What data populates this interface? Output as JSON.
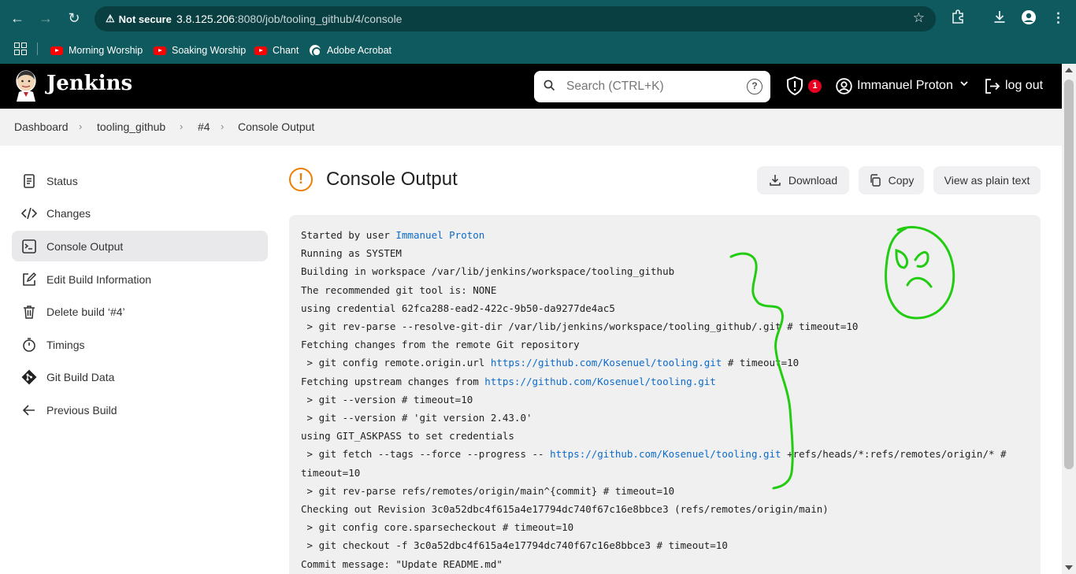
{
  "browser": {
    "security_label": "Not secure",
    "url_host": "3.8.125.206",
    "url_path": ":8080/job/tooling_github/4/console",
    "bookmarks": [
      {
        "label": "Morning Worship",
        "icon": "youtube-icon"
      },
      {
        "label": "Soaking Worship",
        "icon": "youtube-icon"
      },
      {
        "label": "Chant",
        "icon": "youtube-icon"
      },
      {
        "label": "Adobe Acrobat",
        "icon": "acrobat-icon"
      }
    ],
    "theme_color": "#0f5a5e"
  },
  "header": {
    "brand": "Jenkins",
    "search_placeholder": "Search (CTRL+K)",
    "help_label": "?",
    "security_badge_count": "1",
    "user_name": "Immanuel Proton",
    "logout_label": "log out"
  },
  "breadcrumb": {
    "items": [
      "Dashboard",
      "tooling_github",
      "#4",
      "Console Output"
    ]
  },
  "sidebar": {
    "items": [
      {
        "label": "Status",
        "icon": "document-icon"
      },
      {
        "label": "Changes",
        "icon": "code-icon"
      },
      {
        "label": "Console Output",
        "icon": "terminal-icon",
        "active": true
      },
      {
        "label": "Edit Build Information",
        "icon": "edit-icon"
      },
      {
        "label": "Delete build ‘#4’",
        "icon": "trash-icon"
      },
      {
        "label": "Timings",
        "icon": "stopwatch-icon"
      },
      {
        "label": "Git Build Data",
        "icon": "git-icon"
      },
      {
        "label": "Previous Build",
        "icon": "arrow-left-icon"
      }
    ]
  },
  "main": {
    "title": "Console Output",
    "status_icon": "warning-icon",
    "status_color": "#ef7d00",
    "buttons": {
      "download": "Download",
      "copy": "Copy",
      "plain_text": "View as plain text"
    },
    "console_lines": [
      [
        {
          "t": "Started by user "
        },
        {
          "t": "Immanuel Proton",
          "link": true
        }
      ],
      [
        {
          "t": "Running as SYSTEM"
        }
      ],
      [
        {
          "t": "Building in workspace /var/lib/jenkins/workspace/tooling_github"
        }
      ],
      [
        {
          "t": "The recommended git tool is: NONE"
        }
      ],
      [
        {
          "t": "using credential 62fca288-ead2-422c-9b50-da9277de4ac5"
        }
      ],
      [
        {
          "t": " > git rev-parse --resolve-git-dir /var/lib/jenkins/workspace/tooling_github/.git # timeout=10"
        }
      ],
      [
        {
          "t": "Fetching changes from the remote Git repository"
        }
      ],
      [
        {
          "t": " > git config remote.origin.url "
        },
        {
          "t": "https://github.com/Kosenuel/tooling.git",
          "link": true
        },
        {
          "t": " # timeout=10"
        }
      ],
      [
        {
          "t": "Fetching upstream changes from "
        },
        {
          "t": "https://github.com/Kosenuel/tooling.git",
          "link": true
        }
      ],
      [
        {
          "t": " > git --version # timeout=10"
        }
      ],
      [
        {
          "t": " > git --version # 'git version 2.43.0'"
        }
      ],
      [
        {
          "t": "using GIT_ASKPASS to set credentials"
        }
      ],
      [
        {
          "t": " > git fetch --tags --force --progress -- "
        },
        {
          "t": "https://github.com/Kosenuel/tooling.git",
          "link": true
        },
        {
          "t": " +refs/heads/*:refs/remotes/origin/* #"
        }
      ],
      [
        {
          "t": "timeout=10"
        }
      ],
      [
        {
          "t": " > git rev-parse refs/remotes/origin/main^{commit} # timeout=10"
        }
      ],
      [
        {
          "t": "Checking out Revision 3c0a52dbc4f615a4e17794dc740f67c16e8bbce3 (refs/remotes/origin/main)"
        }
      ],
      [
        {
          "t": " > git config core.sparsecheckout # timeout=10"
        }
      ],
      [
        {
          "t": " > git checkout -f 3c0a52dbc4f615a4e17794dc740f67c16e8bbce3 # timeout=10"
        }
      ],
      [
        {
          "t": "Commit message: \"Update README.md\""
        }
      ]
    ]
  },
  "annotation": {
    "color": "#22cc11",
    "shapes": [
      "squiggle-line",
      "frowning-face"
    ]
  }
}
